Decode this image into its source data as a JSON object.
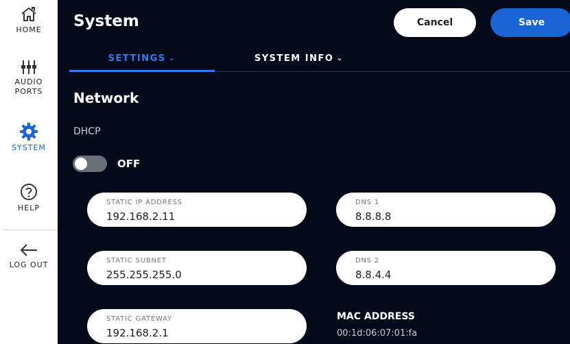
{
  "sidebar": {
    "items": [
      {
        "label": "HOME",
        "icon": "home-icon"
      },
      {
        "label": "AUDIO PORTS",
        "label_line1": "AUDIO",
        "label_line2": "PORTS",
        "icon": "sliders-icon"
      },
      {
        "label": "SYSTEM",
        "icon": "gear-icon",
        "active": true
      },
      {
        "label": "HELP",
        "icon": "question-icon"
      },
      {
        "label": "LOG OUT",
        "icon": "arrow-left-icon"
      }
    ]
  },
  "header": {
    "title": "System",
    "cancel_label": "Cancel",
    "save_label": "Save"
  },
  "tabs": [
    {
      "label": "SETTINGS",
      "active": true
    },
    {
      "label": "SYSTEM INFO",
      "active": false
    }
  ],
  "network": {
    "section_title": "Network",
    "dhcp_label": "DHCP",
    "dhcp_state": "OFF",
    "dhcp_enabled": false,
    "fields": {
      "static_ip": {
        "label": "STATIC IP ADDRESS",
        "value": "192.168.2.11"
      },
      "static_subnet": {
        "label": "STATIC SUBNET",
        "value": "255.255.255.0"
      },
      "static_gateway": {
        "label": "STATIC GATEWAY",
        "value": "192.168.2.1"
      },
      "dns1": {
        "label": "DNS 1",
        "value": "8.8.8.8"
      },
      "dns2": {
        "label": "DNS 2",
        "value": "8.8.4.4"
      }
    },
    "mac_label": "MAC ADDRESS",
    "mac_value": "00:1d:06:07:01:fa"
  },
  "colors": {
    "accent": "#1a64d6",
    "tab_active": "#2e7df6",
    "background": "#050a1a",
    "sidebar": "#ffffff"
  }
}
